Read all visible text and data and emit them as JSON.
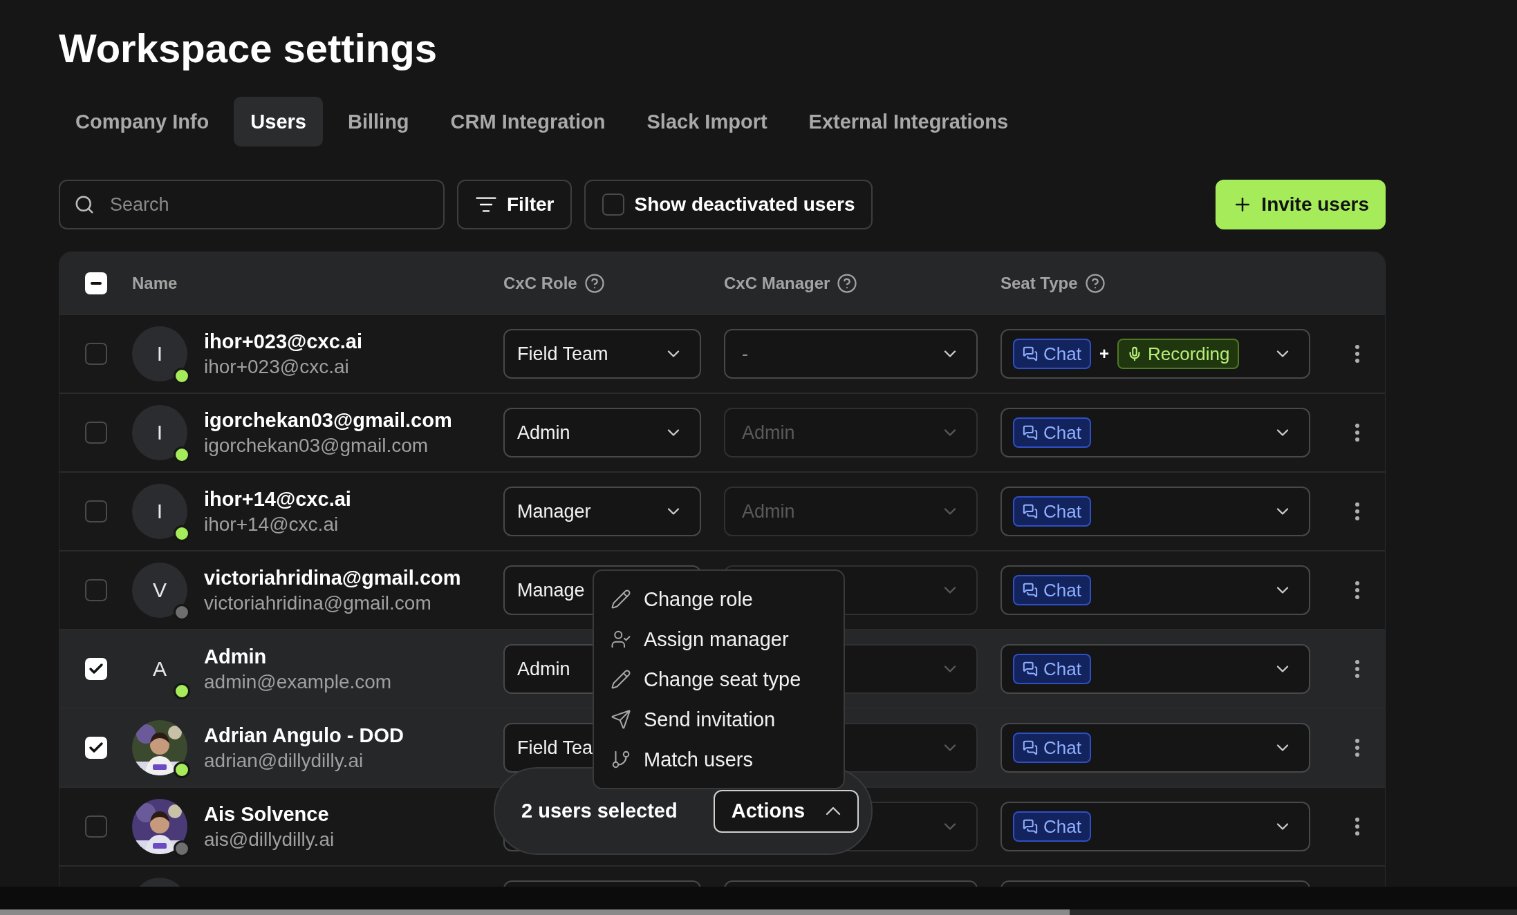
{
  "title": "Workspace settings",
  "tabs": [
    {
      "label": "Company Info",
      "selected": false
    },
    {
      "label": "Users",
      "selected": true
    },
    {
      "label": "Billing",
      "selected": false
    },
    {
      "label": "CRM Integration",
      "selected": false
    },
    {
      "label": "Slack Import",
      "selected": false
    },
    {
      "label": "External Integrations",
      "selected": false
    }
  ],
  "toolbar": {
    "search": {
      "placeholder": "Search"
    },
    "filter": "Filter",
    "show_deactivated": {
      "label": "Show deactivated users",
      "checked": false
    },
    "invite": "Invite users"
  },
  "table": {
    "select_all": {
      "partial": true
    },
    "columns": [
      {
        "label": "Name",
        "help": false
      },
      {
        "label": "CxC Role",
        "help": true
      },
      {
        "label": "CxC Manager",
        "help": true
      },
      {
        "label": "Seat Type",
        "help": true
      }
    ],
    "rows": [
      {
        "checked": false,
        "avatar": {
          "kind": "letter",
          "letter": "I"
        },
        "online": true,
        "name": "ihor+023@cxc.ai",
        "email": "ihor+023@cxc.ai",
        "role": "Field Team",
        "manager": {
          "value": "-",
          "disabled": false
        },
        "seats": [
          {
            "kind": "chat",
            "label": "Chat"
          },
          {
            "kind": "recording",
            "label": "Recording",
            "joiner": "+"
          }
        ]
      },
      {
        "checked": false,
        "avatar": {
          "kind": "letter",
          "letter": "I"
        },
        "online": true,
        "name": "igorchekan03@gmail.com",
        "email": "igorchekan03@gmail.com",
        "role": "Admin",
        "manager": {
          "value": "Admin",
          "disabled": true
        },
        "seats": [
          {
            "kind": "chat",
            "label": "Chat"
          }
        ]
      },
      {
        "checked": false,
        "avatar": {
          "kind": "letter",
          "letter": "I"
        },
        "online": true,
        "name": "ihor+14@cxc.ai",
        "email": "ihor+14@cxc.ai",
        "role": "Manager",
        "manager": {
          "value": "Admin",
          "disabled": true
        },
        "seats": [
          {
            "kind": "chat",
            "label": "Chat"
          }
        ]
      },
      {
        "checked": false,
        "avatar": {
          "kind": "letter",
          "letter": "V"
        },
        "online": false,
        "name": "victoriahridina@gmail.com",
        "email": "victoriahridina@gmail.com",
        "role": "Manage",
        "role_under_menu": true,
        "manager": {
          "disabled": true
        },
        "seats": [
          {
            "kind": "chat",
            "label": "Chat"
          }
        ]
      },
      {
        "checked": true,
        "avatar": {
          "kind": "letter",
          "letter": "A"
        },
        "online": true,
        "name": "Admin",
        "email": "admin@example.com",
        "role": "Admin",
        "role_under_menu": true,
        "manager": {
          "disabled": true
        },
        "seats": [
          {
            "kind": "chat",
            "label": "Chat"
          }
        ]
      },
      {
        "checked": true,
        "avatar": {
          "kind": "picture"
        },
        "online": true,
        "name": "Adrian Angulo - DOD",
        "email": "adrian@dillydilly.ai",
        "role": "Field Tea",
        "role_under_menu": true,
        "manager": {
          "disabled": true
        },
        "seats": [
          {
            "kind": "chat",
            "label": "Chat"
          }
        ]
      },
      {
        "checked": false,
        "avatar": {
          "kind": "picture"
        },
        "online": false,
        "name": "Ais Solvence",
        "email": "ais@dillydilly.ai",
        "manager": {
          "disabled": true
        },
        "seats": [
          {
            "kind": "chat",
            "label": "Chat"
          }
        ]
      },
      {
        "avatar": {
          "kind": "letter"
        },
        "manager": {
          "disabled": false
        }
      }
    ]
  },
  "selection": {
    "count": "2 users selected",
    "actions": {
      "label": "Actions",
      "expanded": true
    }
  },
  "actions_menu": [
    {
      "kind": "edit",
      "label": "Change role"
    },
    {
      "kind": "assign",
      "label": "Assign manager"
    },
    {
      "kind": "edit",
      "label": "Change seat type"
    },
    {
      "kind": "send",
      "label": "Send invitation"
    },
    {
      "kind": "match",
      "label": "Match users"
    }
  ]
}
